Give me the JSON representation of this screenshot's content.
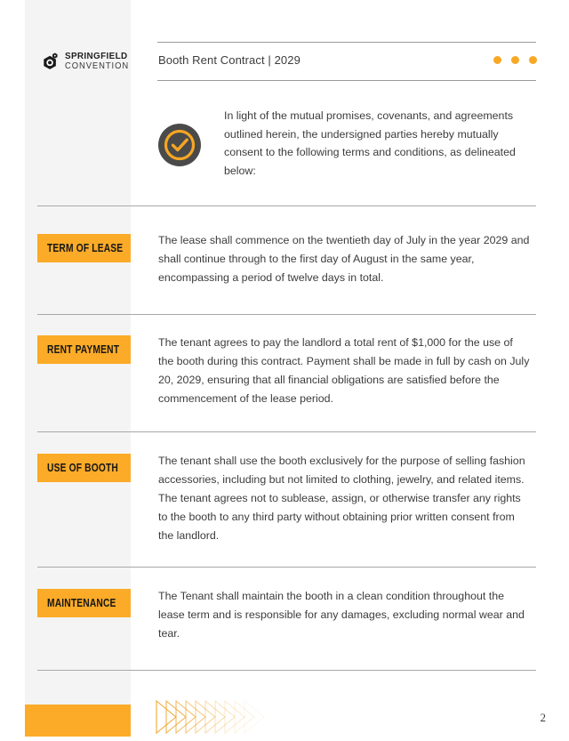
{
  "brand": {
    "logo_line1": "SPRINGFIELD",
    "logo_line2": "CONVENTION",
    "logo_icon": "hexagon-badge-icon"
  },
  "header": {
    "title": "Booth Rent Contract | 2029",
    "dots_count": 3,
    "dot_color": "#f9a825"
  },
  "intro": {
    "badge_icon": "check-circle-icon",
    "text": "In light of the mutual promises, covenants, and agreements outlined herein, the undersigned parties hereby mutually consent to the following terms and conditions, as delineated below:"
  },
  "sections": [
    {
      "label": "TERM OF LEASE",
      "text": "The lease shall commence on the twentieth day of July in the year 2029 and shall continue through to the first day of August in the same year, encompassing a period of twelve days in total."
    },
    {
      "label": "RENT PAYMENT",
      "text": "The tenant agrees to pay the landlord a total rent of $1,000 for the use of the booth during this contract. Payment shall be made in full by cash on July 20, 2029, ensuring that all financial obligations are satisfied before the commencement of the lease period."
    },
    {
      "label": "USE OF BOOTH",
      "text": "The tenant shall use the booth exclusively for the purpose of selling fashion accessories, including but not limited to clothing, jewelry, and related items. The tenant agrees not to sublease, assign, or otherwise transfer any rights to the booth to any third party without obtaining prior written consent from the landlord."
    },
    {
      "label": "MAINTENANCE",
      "text": "The Tenant shall maintain the booth in a clean condition throughout the lease term and is responsible for any damages, excluding normal wear and tear."
    }
  ],
  "footer": {
    "page_number": "2",
    "decoration_icon": "chevron-arrows-decoration"
  },
  "colors": {
    "accent_orange": "#fbab28",
    "dot_orange": "#f9a825",
    "badge_dark": "#4a4a4a",
    "sidebar_gray": "#f4f4f4",
    "rule_gray": "#a8a8a8"
  }
}
